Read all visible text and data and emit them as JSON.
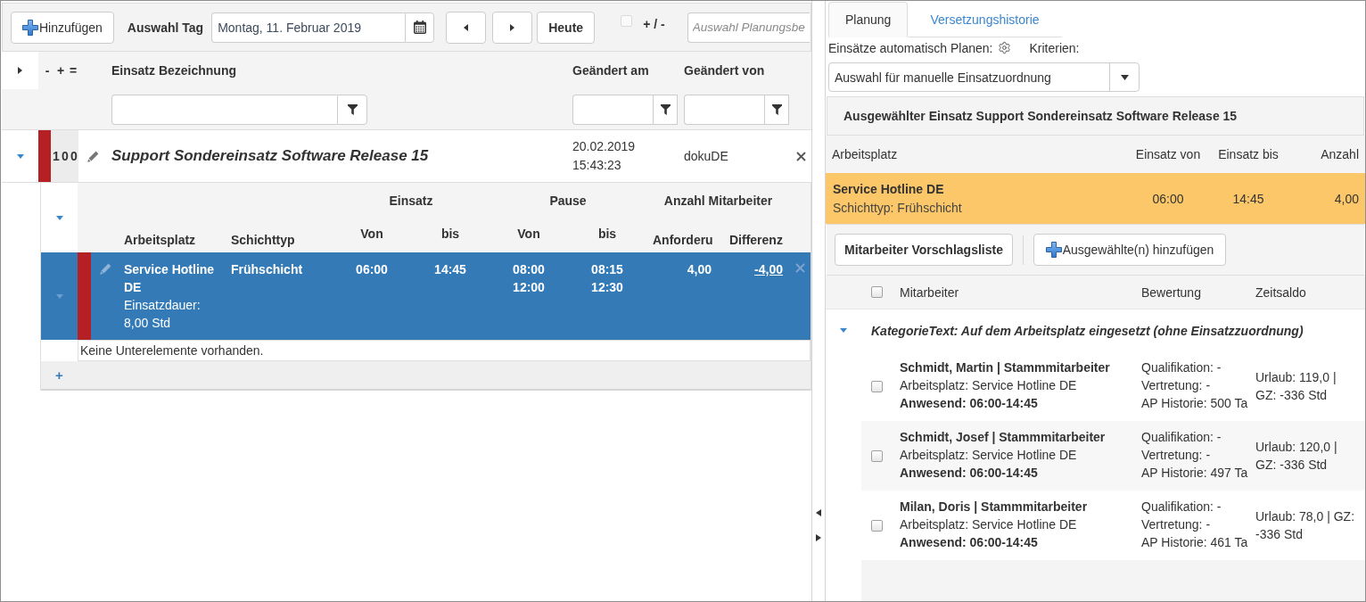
{
  "toolbar": {
    "add_button": "Hinzufügen",
    "day_label": "Auswahl Tag",
    "date_field": {
      "value": "Montag, 11. Februar 2019"
    },
    "today_button": "Heute",
    "plus_minus": {
      "label": "+ / -",
      "checked": false
    },
    "planning_field": {
      "placeholder": "Auswahl Planungsbe"
    }
  },
  "grid": {
    "expanded": false,
    "counter_headers": [
      "-",
      "+",
      "="
    ],
    "columns": [
      "Einsatz Bezeichnung",
      "Geändert am",
      "Geändert von"
    ],
    "rows": [
      {
        "selected": false,
        "expanded": true,
        "color": "#b52025",
        "counts": [
          "1",
          "0",
          "0"
        ],
        "title": "Support Sondereinsatz Software Release 15",
        "changed_at": "20.02.2019 15:43:23",
        "changed_by": "dokuDE",
        "assignments": {
          "expanded": true,
          "groups": [
            "Einsatz",
            "Pause",
            "Anzahl Mitarbeiter"
          ],
          "columns": [
            "Arbeitsplatz",
            "Schichttyp",
            "Von",
            "bis",
            "Von",
            "bis",
            "Anforderu",
            "Differenz"
          ],
          "rows": [
            {
              "selected": true,
              "expanded": true,
              "color": "#b52025",
              "workplace": "Service Hotline DE",
              "duration": "Einsatzdauer: 8,00 Std",
              "shift": "Frühschicht",
              "from": "06:00",
              "to": "14:45",
              "breaks": [
                {
                  "from": "08:00",
                  "to": "08:15"
                },
                {
                  "from": "12:00",
                  "to": "12:30"
                }
              ],
              "required": "4,00",
              "difference": "-4,00",
              "empty_message": "Keine Unterelemente vorhanden."
            }
          ],
          "add_link": "+"
        }
      }
    ]
  },
  "side_panel": {
    "tabs": [
      {
        "label": "Planung",
        "selected": true
      },
      {
        "label": "Versetzungshistorie",
        "selected": false
      }
    ],
    "auto_plan_label": "Einsätze automatisch Planen:",
    "criteria_label": "Kriterien:",
    "criteria_select": {
      "value": "Auswahl für manuelle Einsatzuordnung"
    },
    "selected_assignment": "Ausgewählter Einsatz Support Sondereinsatz Software Release 15",
    "positions": {
      "columns": [
        "Arbeitsplatz",
        "Einsatz von",
        "Einsatz bis",
        "Anzahl"
      ],
      "rows": [
        {
          "selected": true,
          "workplace": "Service Hotline DE",
          "shift": "Schichttyp: Frühschicht",
          "from": "06:00",
          "to": "14:45",
          "count": "4,00"
        }
      ]
    },
    "actions": [
      {
        "kind": "primary",
        "label": "Mitarbeiter Vorschlagsliste"
      },
      {
        "kind": "add",
        "label": "Ausgewählte(n) hinzufügen"
      }
    ],
    "employees": {
      "select_all": false,
      "columns": [
        "Mitarbeiter",
        "Bewertung",
        "Zeitsaldo"
      ],
      "categories": [
        {
          "expanded": true,
          "label": "KategorieText: Auf dem Arbeitsplatz eingesetzt (ohne Einsatzzuordnung)",
          "items": [
            {
              "checked": false,
              "name": "Schmidt, Martin | Stammmitarbeiter",
              "workplace": "Arbeitsplatz: Service Hotline DE",
              "presence": "Anwesend: 06:00-14:45",
              "rating": [
                "Qualifikation: -",
                "Vertretung: -",
                "AP Historie: 500 Ta"
              ],
              "balance": "Urlaub: 119,0 | GZ: -336 Std"
            },
            {
              "checked": false,
              "name": "Schmidt, Josef | Stammmitarbeiter",
              "workplace": "Arbeitsplatz: Service Hotline DE",
              "presence": "Anwesend: 06:00-14:45",
              "rating": [
                "Qualifikation: -",
                "Vertretung: -",
                "AP Historie: 497 Ta"
              ],
              "balance": "Urlaub: 120,0 | GZ: -336 Std"
            },
            {
              "checked": false,
              "name": "Milan, Doris | Stammmitarbeiter",
              "workplace": "Arbeitsplatz: Service Hotline DE",
              "presence": "Anwesend: 06:00-14:45",
              "rating": [
                "Qualifikation: -",
                "Vertretung: -",
                "AP Historie: 461 Ta"
              ],
              "balance": "Urlaub: 78,0 | GZ: -336 Std"
            }
          ]
        }
      ]
    }
  }
}
